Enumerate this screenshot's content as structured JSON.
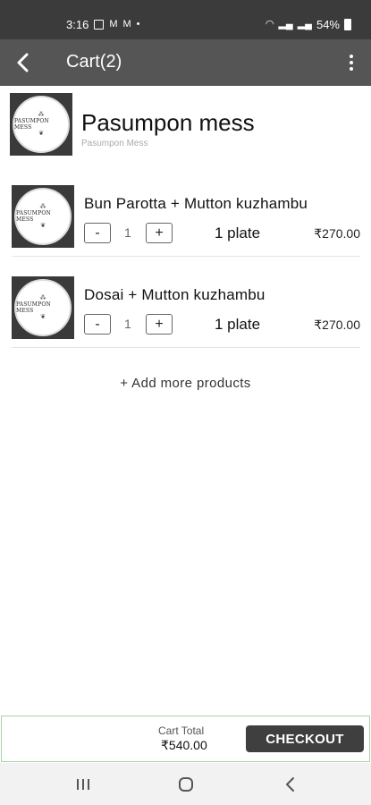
{
  "status_bar": {
    "time": "3:16",
    "battery": "54%"
  },
  "app_bar": {
    "title": "Cart(2)"
  },
  "restaurant": {
    "name": "Pasumpon mess",
    "subtitle": "Pasumpon Mess",
    "logo_text": "PASUMPON MESS"
  },
  "items": [
    {
      "name": "Bun Parotta + Mutton kuzhambu",
      "minus": "-",
      "qty": "1",
      "plus": "+",
      "unit": "1 plate",
      "price": "₹270.00"
    },
    {
      "name": "Dosai + Mutton kuzhambu",
      "minus": "-",
      "qty": "1",
      "plus": "+",
      "unit": "1 plate",
      "price": "₹270.00"
    }
  ],
  "add_more": "+ Add more products",
  "footer": {
    "total_label": "Cart Total",
    "total_value": "₹540.00",
    "checkout_label": "CHECKOUT"
  },
  "colors": {
    "status_bar": "#3b3b3b",
    "app_bar": "#555555",
    "checkout": "#3f3f3f",
    "footer_border": "#a6d3a6"
  }
}
